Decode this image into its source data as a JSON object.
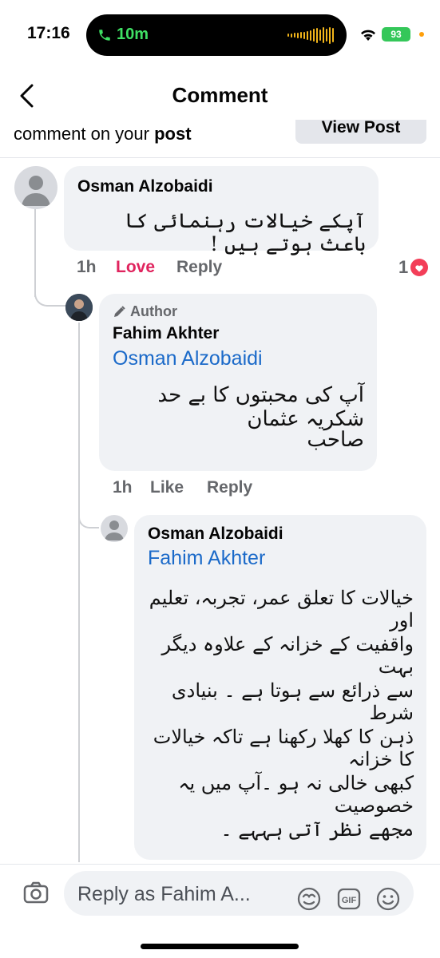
{
  "status_bar": {
    "time": "17:16",
    "call_duration": "10m",
    "battery": "93"
  },
  "header": {
    "title": "Comment"
  },
  "notice": {
    "text_prefix": "comment on your",
    "text_bold": "post",
    "view_post_label": "View Post"
  },
  "comments": [
    {
      "author": "Osman Alzobaidi",
      "text": "آپکے خیالات رہنمائی کا باعث ہوتے ہیں !",
      "time": "1h",
      "reaction_label": "Love",
      "reply_label": "Reply",
      "reaction_count": "1"
    },
    {
      "badge": "Author",
      "author": "Fahim Akhter",
      "mention": "Osman Alzobaidi",
      "text_lines": [
        "آپ کی محبتوں کا بے حد شکریہ عثمان",
        "صاحب"
      ],
      "time": "1h",
      "like_label": "Like",
      "reply_label": "Reply"
    },
    {
      "author": "Osman Alzobaidi",
      "mention": "Fahim Akhter",
      "text_lines": [
        "خیالات کا تعلق عمر، تجربہ، تعلیم اور",
        "واقفیت کے خزانہ کے علاوہ دیگر بہت",
        "سے ذرائع سے ہوتا ہے ۔ بنیادی شرط",
        "ذہن کا کھلا رکھنا ہے تاکہ خیالات کا خزانہ",
        "کبھی خالی نہ ہو ۔آپ میں یہ خصوصیت",
        "مجھے نظر آتی ہہہے ۔"
      ]
    }
  ],
  "composer": {
    "placeholder": "Reply as Fahim A..."
  },
  "colors": {
    "love": "#e0245e",
    "mention": "#1b6ac9",
    "bubble": "#f0f2f5",
    "call_green": "#3fe064"
  }
}
